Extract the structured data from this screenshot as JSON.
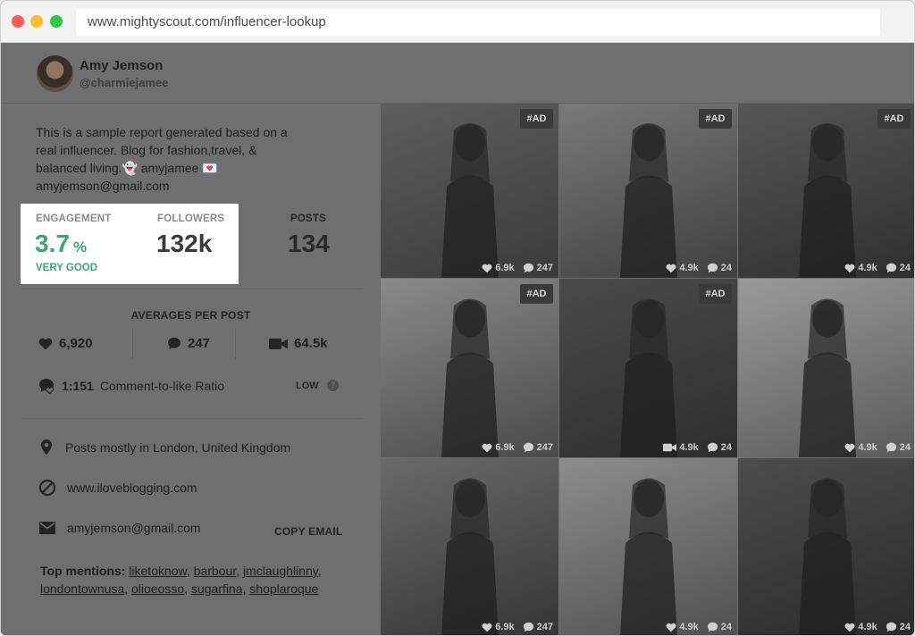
{
  "browser": {
    "url": "www.mightyscout.com/influencer-lookup"
  },
  "profile": {
    "name": "Amy Jemson",
    "handle": "@charmiejamee"
  },
  "bio": {
    "line1": "This is a sample report generated based on a",
    "line2": "real influencer. Blog for fashion,travel, &",
    "line3_text": "balanced living.",
    "line3_emoji1": "👻",
    "line3_mid": "amyjamee",
    "line3_emoji2": "💌",
    "line4": "amyjemson@gmail.com"
  },
  "stats": {
    "engagement_label": "ENGAGEMENT",
    "engagement_value": "3.7",
    "engagement_unit": "%",
    "engagement_rating": "VERY GOOD",
    "followers_label": "FOLLOWERS",
    "followers_value": "132k",
    "posts_label": "POSTS",
    "posts_value": "134"
  },
  "averages": {
    "title": "AVERAGES PER POST",
    "likes": "6,920",
    "comments": "247",
    "views": "64.5k"
  },
  "ratio": {
    "value": "1:151",
    "label": "Comment-to-like Ratio",
    "level": "LOW",
    "help": "?"
  },
  "info": {
    "location": "Posts mostly in London, United Kingdom",
    "website": "www.iloveblogging.com",
    "email": "amyjemson@gmail.com",
    "copy_email": "COPY EMAIL"
  },
  "mentions": {
    "label": "Top mentions:",
    "tags": [
      "liketoknow",
      "barbour",
      "jmclaughlinny",
      "londontownusa",
      "olioeosso",
      "sugarfina",
      "shoplaroque"
    ]
  },
  "posts": [
    {
      "ad": "#AD",
      "likes": "6.9k",
      "comments": "247",
      "views": ""
    },
    {
      "ad": "#AD",
      "likes": "4.9k",
      "comments": "24",
      "views": ""
    },
    {
      "ad": "#AD",
      "likes": "4.9k",
      "comments": "24",
      "views": ""
    },
    {
      "ad": "#AD",
      "likes": "6.9k",
      "comments": "247",
      "views": ""
    },
    {
      "ad": "#AD",
      "likes": "",
      "comments": "24",
      "views": "4.9k"
    },
    {
      "ad": "",
      "likes": "4.9k",
      "comments": "24",
      "views": ""
    },
    {
      "ad": "",
      "likes": "6.9k",
      "comments": "247",
      "views": ""
    },
    {
      "ad": "",
      "likes": "4.9k",
      "comments": "24",
      "views": ""
    },
    {
      "ad": "",
      "likes": "4.9k",
      "comments": "24",
      "views": ""
    }
  ],
  "colors": {
    "accent_green": "#3aa76d",
    "overlay": "#6f6f6f"
  }
}
